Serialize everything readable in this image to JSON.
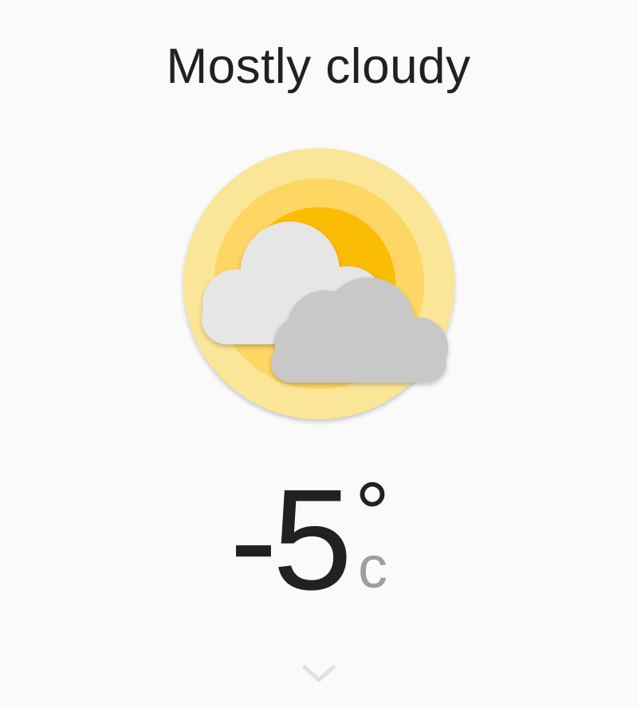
{
  "weather": {
    "condition": "Mostly cloudy",
    "icon": "sun-behind-clouds-icon",
    "temperature": "-5",
    "degree_symbol": "°",
    "unit": "c"
  },
  "controls": {
    "expand_icon": "chevron-down-icon"
  },
  "colors": {
    "background": "#fafafa",
    "text_primary": "#212121",
    "text_secondary": "#9e9e9e",
    "sun_outer": "#fbe596",
    "sun_middle": "#fdd663",
    "sun_inner": "#fbbc04",
    "cloud_light": "#e6e6e6",
    "cloud_dark": "#c8c8c8"
  }
}
